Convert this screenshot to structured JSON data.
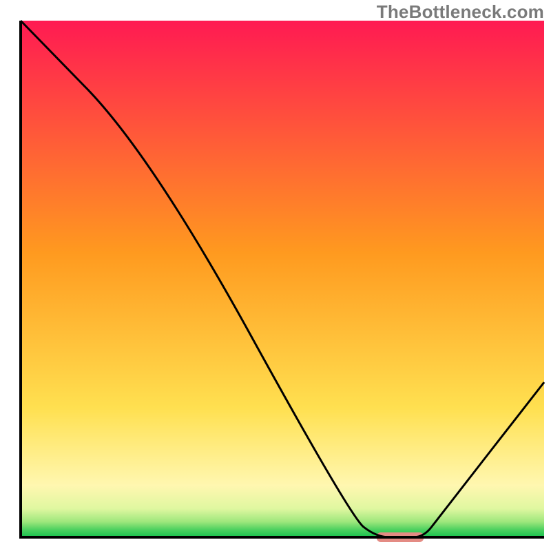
{
  "watermark": "TheBottleneck.com",
  "chart_data": {
    "type": "line",
    "title": "",
    "xlabel": "",
    "ylabel": "",
    "xlim": [
      0,
      100
    ],
    "ylim": [
      0,
      100
    ],
    "grid": false,
    "legend": false,
    "series": [
      {
        "name": "curve",
        "x": [
          0,
          25,
          63,
          68,
          73,
          77,
          80,
          100
        ],
        "values": [
          100,
          74,
          4,
          0,
          0,
          0,
          4,
          30
        ]
      }
    ],
    "marker": {
      "x_start": 68,
      "x_end": 77,
      "y": 0
    },
    "background_stops": [
      {
        "offset": 0.0,
        "color": "#ff1a52"
      },
      {
        "offset": 0.45,
        "color": "#ff9a1f"
      },
      {
        "offset": 0.75,
        "color": "#ffe050"
      },
      {
        "offset": 0.9,
        "color": "#fff7b0"
      },
      {
        "offset": 0.945,
        "color": "#dff7a0"
      },
      {
        "offset": 0.97,
        "color": "#9ee77c"
      },
      {
        "offset": 0.985,
        "color": "#4fd160"
      },
      {
        "offset": 1.0,
        "color": "#17c24e"
      }
    ],
    "marker_color": "#e48b84",
    "line_color": "#000000",
    "frame_color": "#000000"
  }
}
